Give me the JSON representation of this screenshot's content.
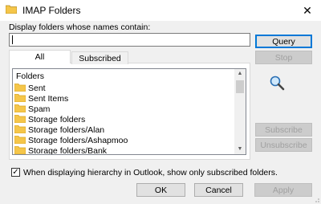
{
  "window": {
    "title": "IMAP Folders",
    "close_glyph": "✕"
  },
  "filter": {
    "label": "Display folders whose names contain:",
    "value": ""
  },
  "buttons": {
    "query": "Query",
    "stop": "Stop",
    "subscribe": "Subscribe",
    "unsubscribe": "Unsubscribe",
    "ok": "OK",
    "cancel": "Cancel",
    "apply": "Apply"
  },
  "tabs": [
    {
      "label": "All",
      "active": true
    },
    {
      "label": "Subscribed",
      "active": false
    }
  ],
  "list": {
    "header": "Folders",
    "items": [
      "Sent",
      "Sent Items",
      "Spam",
      "Storage folders",
      "Storage folders/Alan",
      "Storage folders/Ashapmoo",
      "Storage folders/Bank"
    ]
  },
  "hierarchy_option": {
    "label": "When displaying hierarchy in Outlook, show only subscribed folders.",
    "checked": true,
    "check_glyph": "✓"
  },
  "colors": {
    "folder_fill": "#f5c64a",
    "folder_edge": "#d9a521",
    "accent": "#0078d7"
  },
  "icons": [
    "folder-icon",
    "close-icon",
    "magnifier-icon",
    "checkbox-check-icon"
  ]
}
